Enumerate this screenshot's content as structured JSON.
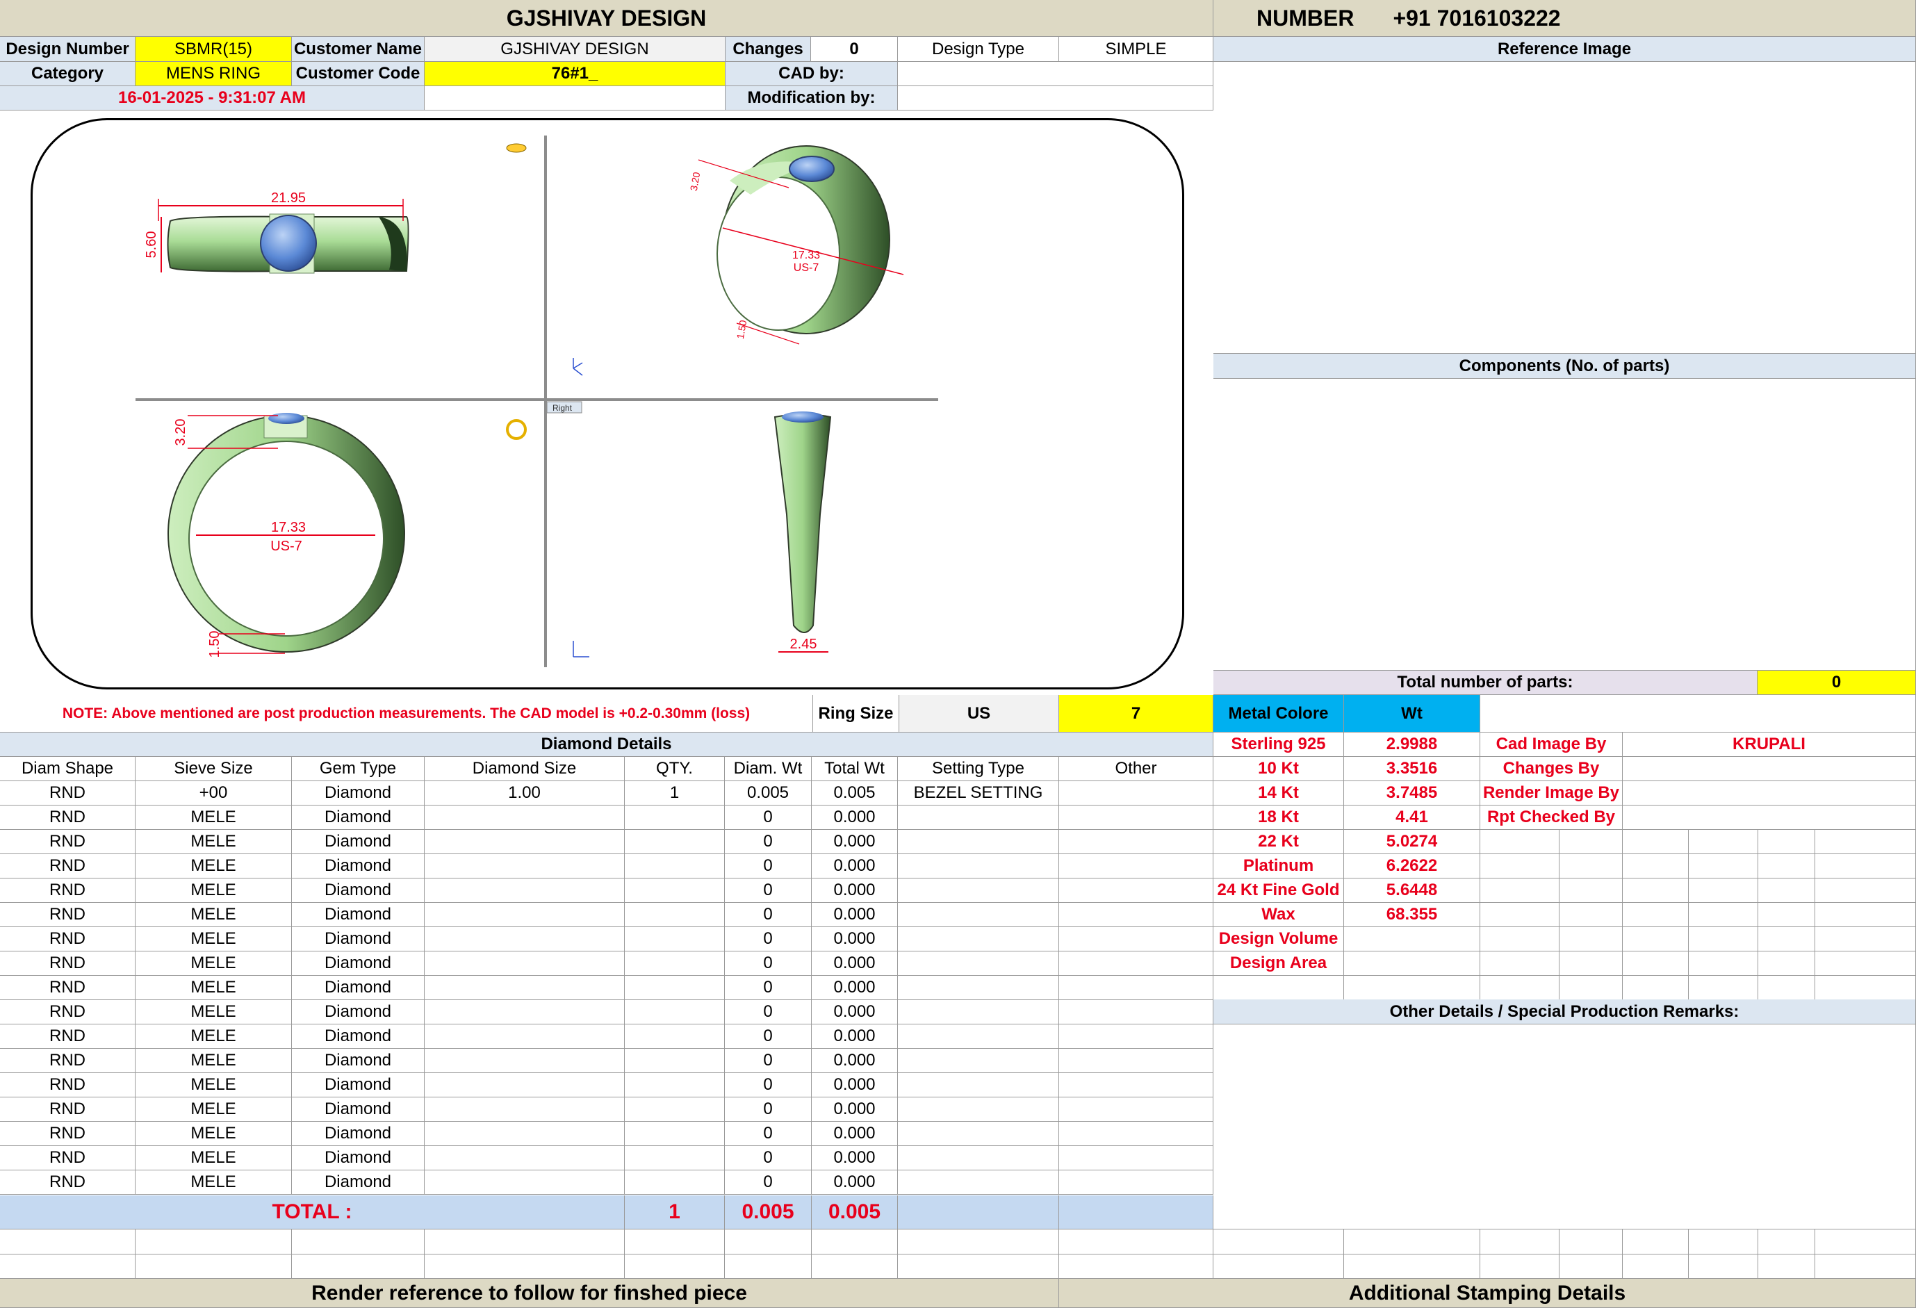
{
  "header": {
    "company": "GJSHIVAY DESIGN",
    "number_label": "NUMBER",
    "number_value": "+91 7016103222"
  },
  "info": {
    "design_number_label": "Design Number",
    "design_number": "SBMR(15)",
    "customer_name_label": "Customer Name",
    "customer_name": "GJSHIVAY DESIGN",
    "changes_label": "Changes",
    "changes": "0",
    "design_type_label": "Design Type",
    "design_type": "SIMPLE",
    "category_label": "Category",
    "category": "MENS RING",
    "customer_code_label": "Customer Code",
    "customer_code": "76#1_",
    "cad_by_label": "CAD by:",
    "modification_by_label": "Modification by:",
    "date": "16-01-2025 - 9:31:07 AM"
  },
  "drawing": {
    "top_width": "21.95",
    "top_height": "5.60",
    "iso_height": "3.20",
    "iso_diam": "17.33",
    "iso_size": "US-7",
    "iso_band": "1.50",
    "front_height": "3.20",
    "front_diam": "17.33",
    "front_size": "US-7",
    "front_band": "1.50",
    "side_width": "2.45",
    "view_label": "Right"
  },
  "right_panel": {
    "reference_image": "Reference Image",
    "components": "Components (No. of parts)",
    "total_parts_label": "Total number of parts:",
    "total_parts": "0",
    "other_details": "Other Details / Special Production Remarks:"
  },
  "note": "NOTE: Above mentioned are post production measurements. The CAD model is +0.2-0.30mm (loss)",
  "ring_size": {
    "label": "Ring Size",
    "system": "US",
    "value": "7"
  },
  "metal": {
    "color_label": "Metal Colore",
    "wt_label": "Wt",
    "rows": [
      {
        "name": "Sterling 925",
        "wt": "2.9988"
      },
      {
        "name": "10 Kt",
        "wt": "3.3516"
      },
      {
        "name": "14 Kt",
        "wt": "3.7485"
      },
      {
        "name": "18 Kt",
        "wt": "4.41"
      },
      {
        "name": "22 Kt",
        "wt": "5.0274"
      },
      {
        "name": "Platinum",
        "wt": "6.2622"
      },
      {
        "name": "24 Kt Fine Gold",
        "wt": "5.6448"
      },
      {
        "name": "Wax",
        "wt": "68.355"
      },
      {
        "name": "Design Volume",
        "wt": ""
      },
      {
        "name": "Design Area",
        "wt": ""
      }
    ]
  },
  "credits": [
    {
      "label": "Cad Image By",
      "value": "KRUPALI"
    },
    {
      "label": "Changes By",
      "value": ""
    },
    {
      "label": "Render Image By",
      "value": ""
    },
    {
      "label": "Rpt Checked By",
      "value": ""
    }
  ],
  "diamond": {
    "title": "Diamond Details",
    "columns": [
      "Diam Shape",
      "Sieve Size",
      "Gem Type",
      "Diamond Size",
      "QTY.",
      "Diam. Wt",
      "Total Wt",
      "Setting Type",
      "Other"
    ],
    "rows": [
      [
        "RND",
        "+00",
        "Diamond",
        "1.00",
        "1",
        "0.005",
        "0.005",
        "BEZEL SETTING",
        ""
      ],
      [
        "RND",
        "MELE",
        "Diamond",
        "",
        "",
        "0",
        "0.000",
        "",
        ""
      ],
      [
        "RND",
        "MELE",
        "Diamond",
        "",
        "",
        "0",
        "0.000",
        "",
        ""
      ],
      [
        "RND",
        "MELE",
        "Diamond",
        "",
        "",
        "0",
        "0.000",
        "",
        ""
      ],
      [
        "RND",
        "MELE",
        "Diamond",
        "",
        "",
        "0",
        "0.000",
        "",
        ""
      ],
      [
        "RND",
        "MELE",
        "Diamond",
        "",
        "",
        "0",
        "0.000",
        "",
        ""
      ],
      [
        "RND",
        "MELE",
        "Diamond",
        "",
        "",
        "0",
        "0.000",
        "",
        ""
      ],
      [
        "RND",
        "MELE",
        "Diamond",
        "",
        "",
        "0",
        "0.000",
        "",
        ""
      ],
      [
        "RND",
        "MELE",
        "Diamond",
        "",
        "",
        "0",
        "0.000",
        "",
        ""
      ],
      [
        "RND",
        "MELE",
        "Diamond",
        "",
        "",
        "0",
        "0.000",
        "",
        ""
      ],
      [
        "RND",
        "MELE",
        "Diamond",
        "",
        "",
        "0",
        "0.000",
        "",
        ""
      ],
      [
        "RND",
        "MELE",
        "Diamond",
        "",
        "",
        "0",
        "0.000",
        "",
        ""
      ],
      [
        "RND",
        "MELE",
        "Diamond",
        "",
        "",
        "0",
        "0.000",
        "",
        ""
      ],
      [
        "RND",
        "MELE",
        "Diamond",
        "",
        "",
        "0",
        "0.000",
        "",
        ""
      ],
      [
        "RND",
        "MELE",
        "Diamond",
        "",
        "",
        "0",
        "0.000",
        "",
        ""
      ],
      [
        "RND",
        "MELE",
        "Diamond",
        "",
        "",
        "0",
        "0.000",
        "",
        ""
      ],
      [
        "RND",
        "MELE",
        "Diamond",
        "",
        "",
        "0",
        "0.000",
        "",
        ""
      ]
    ],
    "total_label": "TOTAL :",
    "total_qty": "1",
    "total_diam_wt": "0.005",
    "total_wt": "0.005"
  },
  "footer": {
    "render_reference": "Render reference to follow for finshed piece",
    "stamping": "Additional Stamping Details"
  }
}
